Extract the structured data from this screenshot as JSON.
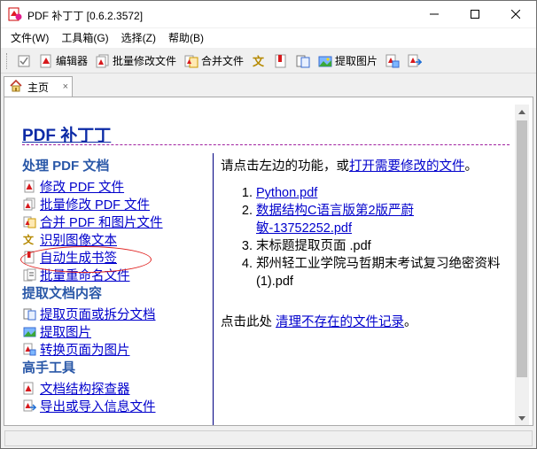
{
  "window": {
    "title": "PDF 补丁丁 [0.6.2.3572]"
  },
  "menu": {
    "items": [
      "文件(W)",
      "工具箱(G)",
      "选择(Z)",
      "帮助(B)"
    ]
  },
  "toolbar": {
    "editor": "编辑器",
    "batch_modify": "批量修改文件",
    "merge": "合并文件",
    "extract_images": "提取图片"
  },
  "tabs": {
    "home": "主页",
    "close_glyph": "×"
  },
  "home": {
    "title": "PDF 补丁丁",
    "sections": [
      {
        "heading": "处理 PDF 文档",
        "links": [
          "修改 PDF 文件",
          "批量修改 PDF 文件",
          "合并 PDF 和图片文件",
          "识别图像文本",
          "自动生成书签",
          "批量重命名文件"
        ]
      },
      {
        "heading": "提取文档内容",
        "links": [
          "提取页面或拆分文档",
          "提取图片",
          "转换页面为图片"
        ]
      },
      {
        "heading": "高手工具",
        "links": [
          "文档结构探查器",
          "导出或导入信息文件"
        ]
      }
    ],
    "intro_prefix": "请点击左边的功能，或",
    "intro_link": "打开需要修改的文件",
    "intro_suffix": "。",
    "recent_files": [
      {
        "name": "Python.pdf",
        "linked": true
      },
      {
        "name": "数据结构C语言版第2版严蔚敏-13752252.pdf",
        "linked": true
      },
      {
        "name": "末标题提取页面 .pdf",
        "linked": false
      },
      {
        "name": "郑州轻工业学院马哲期末考试复习绝密资料 (1).pdf",
        "linked": false
      }
    ],
    "foot_prefix": "点击此处 ",
    "foot_link": "清理不存在的文件记录",
    "foot_suffix": "。"
  },
  "colors": {
    "title_blue": "#0b2aa6",
    "section_blue": "#2a58a8",
    "link_blue": "#0000cc",
    "annotation_red": "#e0201e"
  }
}
